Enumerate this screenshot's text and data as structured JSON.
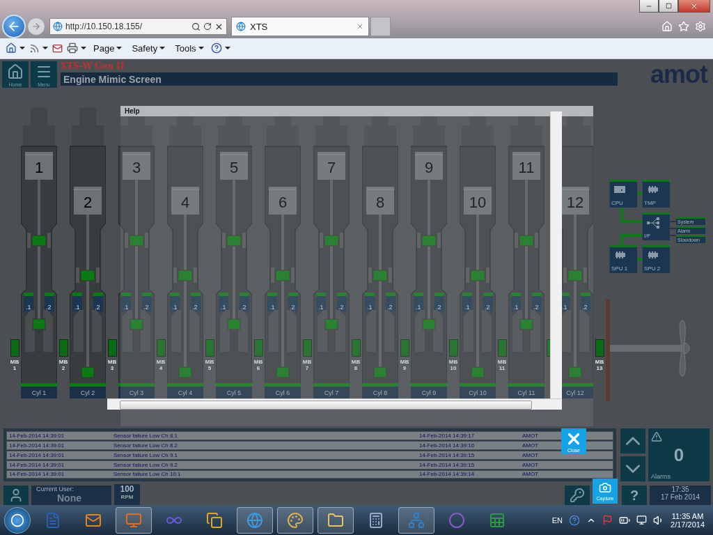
{
  "browser": {
    "address": "http://10.150.18.155/",
    "tabs": [
      {
        "label": "XTS",
        "selected": true
      }
    ],
    "menus": [
      "Page",
      "Safety",
      "Tools"
    ]
  },
  "app": {
    "nav": [
      {
        "label": "Home",
        "kind": "home"
      },
      {
        "label": "Menu",
        "kind": "menu"
      }
    ],
    "subtitle": "XTS-W Gen II",
    "title": "Engine Mimic Screen",
    "logo": "amot"
  },
  "engine": {
    "cylinders": [
      {
        "number": "1",
        "name": "Cyl 1",
        "piston_down": false,
        "bearings": [
          ".1",
          ".2"
        ]
      },
      {
        "number": "2",
        "name": "Cyl 2",
        "piston_down": true,
        "bearings": [
          ".1",
          ".2"
        ]
      },
      {
        "number": "3",
        "name": "Cyl 3",
        "piston_down": false,
        "bearings": [
          ".1",
          ".2"
        ]
      },
      {
        "number": "4",
        "name": "Cyl 4",
        "piston_down": true,
        "bearings": [
          ".1",
          ".2"
        ]
      },
      {
        "number": "5",
        "name": "Cyl 5",
        "piston_down": false,
        "bearings": [
          ".1",
          ".2"
        ]
      },
      {
        "number": "6",
        "name": "Cyl 6",
        "piston_down": true,
        "bearings": [
          ".1",
          ".2"
        ]
      },
      {
        "number": "7",
        "name": "Cyl 7",
        "piston_down": false,
        "bearings": [
          ".1",
          ".2"
        ]
      },
      {
        "number": "8",
        "name": "Cyl 8",
        "piston_down": true,
        "bearings": [
          ".1",
          ".2"
        ]
      },
      {
        "number": "9",
        "name": "Cyl 9",
        "piston_down": false,
        "bearings": [
          ".1",
          ".2"
        ]
      },
      {
        "number": "10",
        "name": "Cyl 10",
        "piston_down": true,
        "bearings": [
          ".1",
          ".2"
        ]
      },
      {
        "number": "11",
        "name": "Cyl 11",
        "piston_down": false,
        "bearings": [
          ".1",
          ".2"
        ]
      },
      {
        "number": "12",
        "name": "Cyl 12",
        "piston_down": true,
        "bearings": [
          ".1",
          ".2"
        ]
      }
    ],
    "main_bearing_labels": [
      "MB 1",
      "MB 2",
      "MB 3",
      "MB 4",
      "MB 5",
      "MB 6",
      "MB 7",
      "MB 8",
      "MB 9",
      "MB 10",
      "MB 11"
    ],
    "last_main_bearing": "MB 13"
  },
  "controller": {
    "modules": [
      {
        "label": "CPU",
        "kind": "cpu"
      },
      {
        "label": "TMP",
        "kind": "chip"
      },
      {
        "label": "I/F",
        "kind": "hub"
      },
      {
        "label": "SPU 1",
        "kind": "chip"
      },
      {
        "label": "SPU 2",
        "kind": "chip"
      }
    ],
    "outputs": [
      "System",
      "Alarm",
      "Slowdown"
    ]
  },
  "alarms": {
    "rows": [
      {
        "timestamp": "14-Feb-2014 14:39:01",
        "message": "Sensor failure Low Ch 8.1",
        "timestamp_2": "14-Feb-2014 14:39:17",
        "source": "AMOT"
      },
      {
        "timestamp": "14-Feb-2014 14:39:01",
        "message": "Sensor failure Low Ch 8.2",
        "timestamp_2": "14-Feb-2014 14:39:16",
        "source": "AMOT"
      },
      {
        "timestamp": "14-Feb-2014 14:39:01",
        "message": "Sensor failure Low Ch 9.1",
        "timestamp_2": "14-Feb-2014 14:39:15",
        "source": "AMOT"
      },
      {
        "timestamp": "14-Feb-2014 14:39:01",
        "message": "Sensor failure Low Ch 9.2",
        "timestamp_2": "14-Feb-2014 14:39:15",
        "source": "AMOT"
      },
      {
        "timestamp": "14-Feb-2014 14:39:01",
        "message": "Sensor failure Low Ch 10.1",
        "timestamp_2": "14-Feb-2014 14:39:14",
        "source": "AMOT"
      }
    ]
  },
  "status": {
    "alarm_count": "0",
    "alarm_label": "Alarms",
    "user_label": "Current User:",
    "user": "None",
    "rpm": "100",
    "rpm_unit": "RPM",
    "capture": "Capture",
    "help": "?",
    "time": "17:35",
    "date": "17 Feb 2014"
  },
  "dialog": {
    "title": "Help",
    "close": "Close"
  },
  "taskbar": {
    "language": "EN",
    "time": "11:35 AM",
    "date": "2/17/2014"
  }
}
